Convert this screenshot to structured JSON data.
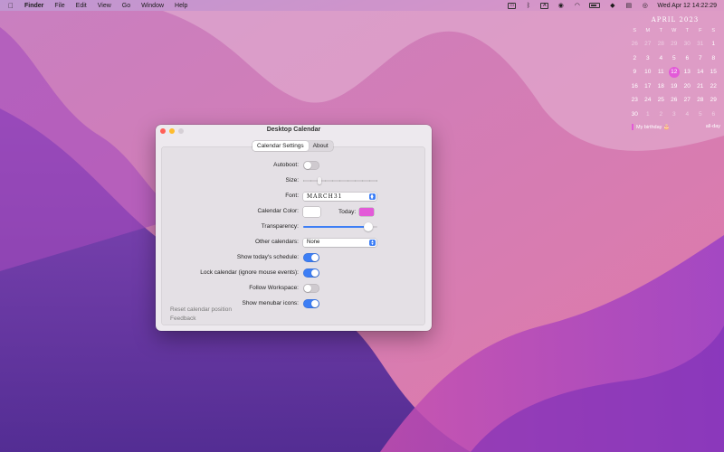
{
  "menubar": {
    "apple_icon": "apple-icon",
    "app_name": "Finder",
    "menus": [
      "File",
      "Edit",
      "View",
      "Go",
      "Window",
      "Help"
    ],
    "input_source": "A",
    "datetime": "Wed Apr 12  14:22:29"
  },
  "calendar_widget": {
    "month": "APRIL 2023",
    "weekdays": [
      "S",
      "M",
      "T",
      "W",
      "T",
      "F",
      "S"
    ],
    "days": [
      {
        "d": "26",
        "other": true
      },
      {
        "d": "27",
        "other": true
      },
      {
        "d": "28",
        "other": true
      },
      {
        "d": "29",
        "other": true
      },
      {
        "d": "30",
        "other": true
      },
      {
        "d": "31",
        "other": true
      },
      {
        "d": "1"
      },
      {
        "d": "2"
      },
      {
        "d": "3"
      },
      {
        "d": "4"
      },
      {
        "d": "5"
      },
      {
        "d": "6"
      },
      {
        "d": "7"
      },
      {
        "d": "8"
      },
      {
        "d": "9"
      },
      {
        "d": "10"
      },
      {
        "d": "11"
      },
      {
        "d": "12",
        "today": true
      },
      {
        "d": "13"
      },
      {
        "d": "14"
      },
      {
        "d": "15"
      },
      {
        "d": "16"
      },
      {
        "d": "17"
      },
      {
        "d": "18"
      },
      {
        "d": "19"
      },
      {
        "d": "20"
      },
      {
        "d": "21"
      },
      {
        "d": "22"
      },
      {
        "d": "23"
      },
      {
        "d": "24"
      },
      {
        "d": "25"
      },
      {
        "d": "26"
      },
      {
        "d": "27"
      },
      {
        "d": "28"
      },
      {
        "d": "29"
      },
      {
        "d": "30"
      },
      {
        "d": "1",
        "other": true
      },
      {
        "d": "2",
        "other": true
      },
      {
        "d": "3",
        "other": true
      },
      {
        "d": "4",
        "other": true
      },
      {
        "d": "5",
        "other": true
      },
      {
        "d": "6",
        "other": true
      }
    ],
    "event": {
      "title": "My birthday 🎂",
      "time": "all-day"
    }
  },
  "window": {
    "title": "Desktop Calendar",
    "tabs": [
      "Calendar Settings",
      "About"
    ],
    "active_tab": "Calendar Settings",
    "labels": {
      "autoboot": "Autoboot:",
      "size": "Size:",
      "font": "Font:",
      "calendar_color": "Calendar Color:",
      "today": "Today:",
      "transparency": "Transparency:",
      "other_calendars": "Other calendars:",
      "show_schedule": "Show today's schedule:",
      "lock_calendar": "Lock calendar (ignore mouse events):",
      "follow_workspace": "Follow Workspace:",
      "show_menubar_icons": "Show menubar icons:"
    },
    "values": {
      "autoboot": false,
      "size": 0.2,
      "font": "MARCH31",
      "calendar_color": "#ffffff",
      "today_color": "#e35ad8",
      "transparency": 0.93,
      "other_calendars": "None",
      "show_schedule": true,
      "lock_calendar": true,
      "follow_workspace": false,
      "show_menubar_icons": true
    },
    "links": {
      "reset": "Reset calendar position",
      "feedback": "Feedback"
    }
  },
  "colors": {
    "accent": "#3d7ef5",
    "today": "#e35ad8"
  }
}
